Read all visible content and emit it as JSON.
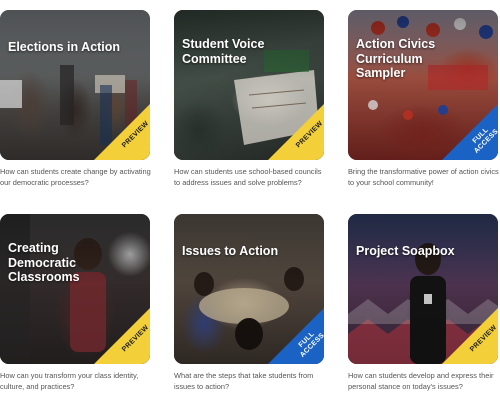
{
  "cards": [
    {
      "title": "Elections in Action",
      "badge": "PREVIEW",
      "description": "How can students create change by activating our democratic processes?"
    },
    {
      "title": "Student Voice\nCommittee",
      "badge": "PREVIEW",
      "description": "How can students use school-based councils to address issues and solve problems?"
    },
    {
      "title": "Action Civics\nCurriculum\nSampler",
      "badge": "FULL\nACCESS",
      "description": "Bring the transformative power of action civics to your school community!"
    },
    {
      "title": "Creating\nDemocratic\nClassrooms",
      "badge": "PREVIEW",
      "description": "How can you transform your class identity, culture, and practices?"
    },
    {
      "title": "Issues to Action",
      "badge": "FULL\nACCESS",
      "description": "What are the steps that take students from issues to action?"
    },
    {
      "title": "Project Soapbox",
      "badge": "PREVIEW",
      "description": "How can students develop and express their personal stance on today's issues?"
    }
  ],
  "colors": {
    "preview_badge": "#f3cf3a",
    "full_access_badge": "#1a62c4",
    "description_text": "#555555"
  }
}
